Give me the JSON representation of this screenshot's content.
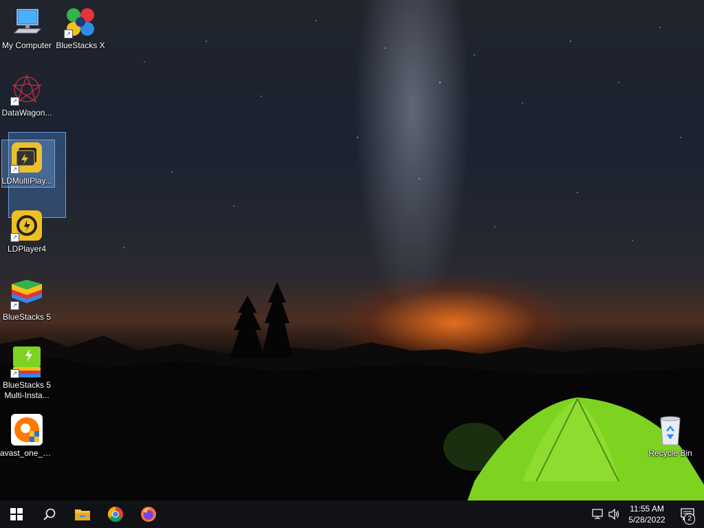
{
  "desktop": {
    "icons": [
      {
        "label": "My Computer"
      },
      {
        "label": "BlueStacks X"
      },
      {
        "label": "DataWagon..."
      },
      {
        "label": "LDMultiPlay..."
      },
      {
        "label": "LDPlayer4"
      },
      {
        "label": "BlueStacks 5"
      },
      {
        "label": "BlueStacks 5 Multi-Insta..."
      },
      {
        "label": "avast_one_e..."
      },
      {
        "label": "Recycle Bin"
      }
    ]
  },
  "taskbar": {
    "apps": [
      "start-icon",
      "search-icon",
      "file-explorer-icon",
      "chrome-icon",
      "firefox-icon"
    ],
    "clock": {
      "time": "11:55 AM",
      "date": "5/28/2022"
    },
    "notifications_count": "2"
  },
  "colors": {
    "taskbar": "#101216",
    "accent": "#1a5fd0",
    "tent": "#7ed321"
  }
}
